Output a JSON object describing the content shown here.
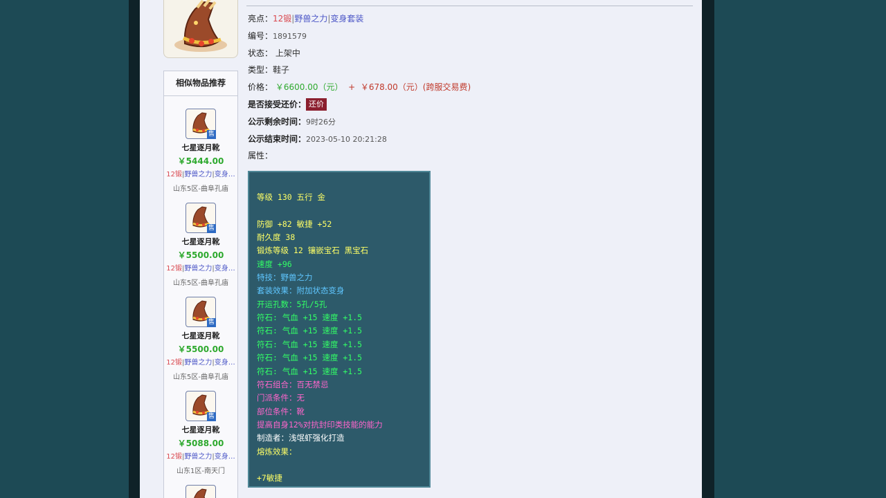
{
  "item": {
    "highlights": [
      "12锻",
      "野兽之力",
      "变身套装"
    ],
    "id_label": "编号：",
    "id": "1891579",
    "status_label": "状态：",
    "status": "上架中",
    "type_label": "类型：",
    "type": "鞋子",
    "price_label": "价格：",
    "price": "￥6600.00（元）",
    "plus": "+",
    "fee": "￥678.00（元）(跨服交易费)",
    "counter_label": "是否接受还价：",
    "counter_button": "还价",
    "remain_label": "公示剩余时间：",
    "remain": "9时26分",
    "end_label": "公示结束时间：",
    "end": "2023-05-10 20:21:28",
    "attr_label": "属性：",
    "highlight_label": "亮点："
  },
  "attributes": [
    {
      "text": "等级 130 五行 金",
      "color": "yellow"
    },
    {
      "text": "防御 +82 敏捷 +52",
      "color": "yellow"
    },
    {
      "text": "耐久度 38",
      "color": "yellow"
    },
    {
      "text": "锻炼等级 12 镶嵌宝石 黑宝石",
      "color": "yellow"
    },
    {
      "text": "速度 +96",
      "color": "green"
    },
    {
      "text": "特技：野兽之力",
      "color": "blue"
    },
    {
      "text": "套装效果：附加状态变身",
      "color": "blue"
    },
    {
      "text": "开运孔数：5孔/5孔",
      "color": "green"
    },
    {
      "text": "符石: 气血 +15 速度 +1.5",
      "color": "green"
    },
    {
      "text": "符石: 气血 +15 速度 +1.5",
      "color": "green"
    },
    {
      "text": "符石: 气血 +15 速度 +1.5",
      "color": "green"
    },
    {
      "text": "符石: 气血 +15 速度 +1.5",
      "color": "green"
    },
    {
      "text": "符石: 气血 +15 速度 +1.5",
      "color": "green"
    },
    {
      "text": "符石组合：百无禁忌",
      "color": "pink"
    },
    {
      "text": "门派条件：无",
      "color": "pink"
    },
    {
      "text": "部位条件：靴",
      "color": "pink"
    },
    {
      "text": "提高自身12%对抗封印类技能的能力",
      "color": "pink"
    },
    {
      "text": "制造者：浅氓虾强化打造",
      "color": "white"
    },
    {
      "text": "熔炼效果：",
      "color": "yellow"
    },
    {
      "text": "+7敏捷",
      "color": "yellow"
    }
  ],
  "similar": {
    "title": "相似物品推荐",
    "badge": "售",
    "items": [
      {
        "name": "七星逐月靴",
        "price": "￥5444.00",
        "tag1": "12锻",
        "tag2": "野兽之力",
        "tag3": "变身…",
        "location": "山东5区-曲阜孔庙"
      },
      {
        "name": "七星逐月靴",
        "price": "￥5500.00",
        "tag1": "12锻",
        "tag2": "野兽之力",
        "tag3": "变身…",
        "location": "山东5区-曲阜孔庙"
      },
      {
        "name": "七星逐月靴",
        "price": "￥5500.00",
        "tag1": "12锻",
        "tag2": "野兽之力",
        "tag3": "变身…",
        "location": "山东5区-曲阜孔庙"
      },
      {
        "name": "七星逐月靴",
        "price": "￥5088.00",
        "tag1": "12锻",
        "tag2": "野兽之力",
        "tag3": "变身…",
        "location": "山东1区-南天门"
      }
    ]
  }
}
